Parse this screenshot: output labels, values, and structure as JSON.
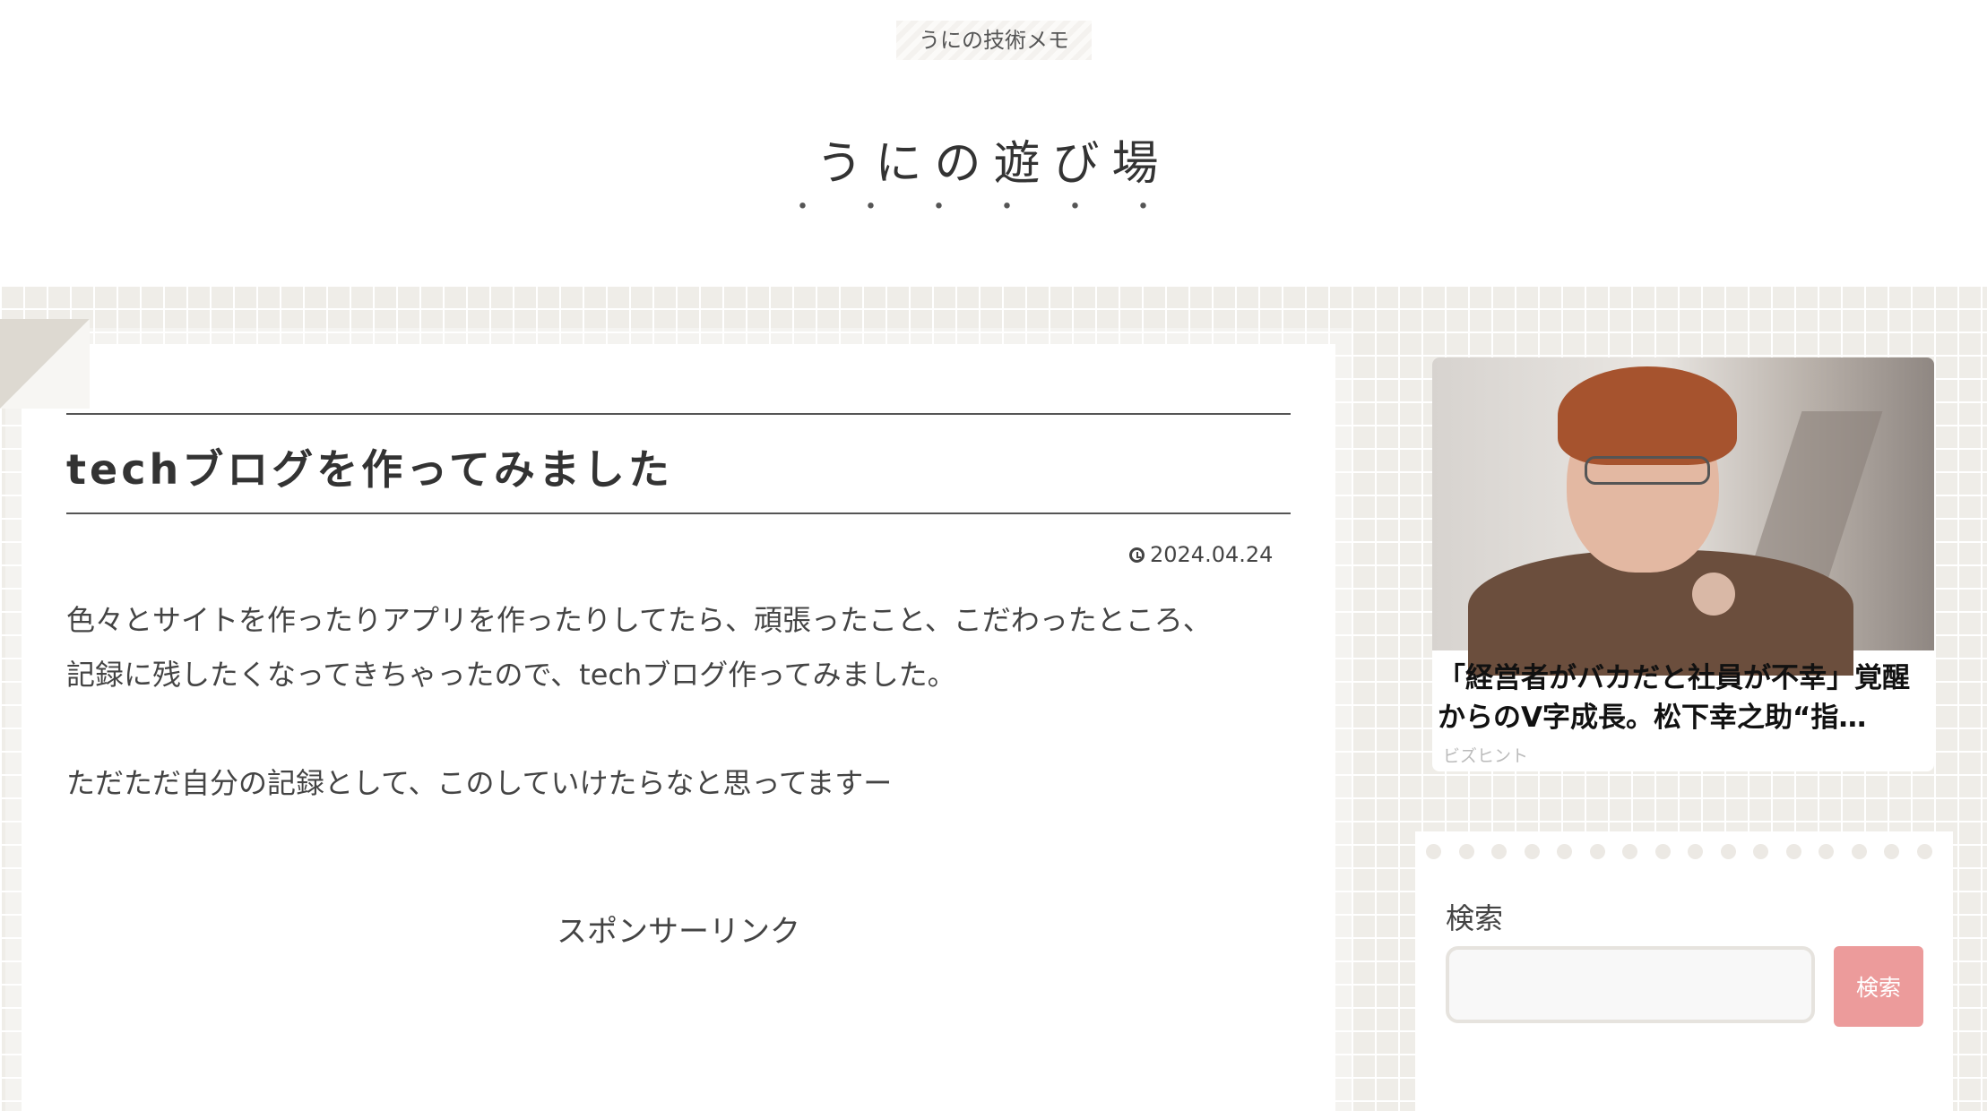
{
  "header": {
    "tagline": "うにの技術メモ",
    "site_title": "うにの遊び場",
    "title_dots": "・・・・・・"
  },
  "post": {
    "title": "techブログを作ってみました",
    "date": "2024.04.24",
    "paragraphs": [
      "色々とサイトを作ったりアプリを作ったりしてたら、頑張ったこと、こだわったところ、",
      "記録に残したくなってきちゃったので、techブログ作ってみました。",
      "ただただ自分の記録として、このしていけたらなと思ってますー"
    ],
    "sponsor_label": "スポンサーリンク"
  },
  "sidebar": {
    "ad": {
      "title": "「経営者がバカだと社員が不幸」覚醒からのV字成長。松下幸之助“指…",
      "source": "ビズヒント"
    },
    "search": {
      "widget_title": "検索",
      "button_label": "検索",
      "input_value": ""
    }
  },
  "colors": {
    "accent_button": "#ec9b9b",
    "background": "#efede8"
  }
}
